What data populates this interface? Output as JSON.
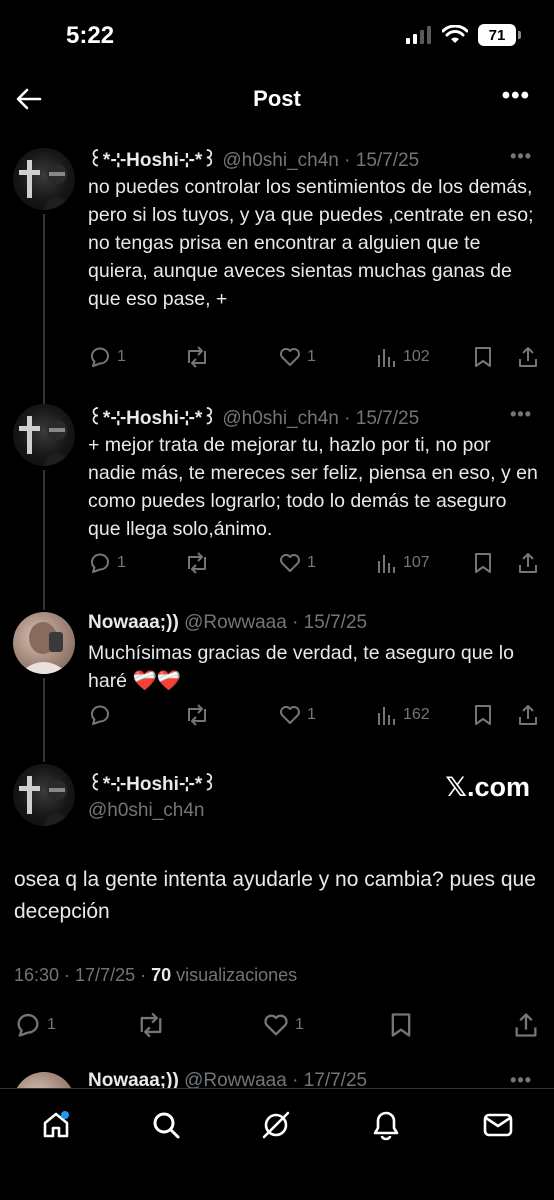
{
  "status_bar": {
    "time": "5:22",
    "battery": "71"
  },
  "header": {
    "title": "Post"
  },
  "tweets": [
    {
      "display_name": "꒰*⊹Hoshi⊹*꒱",
      "handle": "@h0shi_ch4n",
      "date": "· 15/7/25",
      "text": "no puedes controlar los sentimientos de los demás, pero si los tuyos, y ya que puedes ,centrate en eso; no tengas prisa en encontrar a alguien que te quiera, aunque aveces sientas muchas ganas de que eso pase, +",
      "replies": "1",
      "reposts": "",
      "likes": "1",
      "views": "102"
    },
    {
      "display_name": "꒰*⊹Hoshi⊹*꒱",
      "handle": "@h0shi_ch4n",
      "date": "· 15/7/25",
      "text": "+ mejor trata de mejorar tu, hazlo por ti, no por nadie más, te mereces ser feliz, piensa en eso, y en como puedes lograrlo; todo lo demás te aseguro que llega solo,ánimo.",
      "replies": "1",
      "reposts": "",
      "likes": "1",
      "views": "107"
    },
    {
      "display_name": "Nowaaa;))",
      "handle": "@Rowwaaa",
      "date": "· 15/7/25",
      "text": "Muchísimas gracias de verdad, te aseguro que lo haré ❤️‍🩹❤️‍🩹",
      "replies": "",
      "reposts": "",
      "likes": "1",
      "views": "162"
    }
  ],
  "main_post": {
    "display_name": "꒰*⊹Hoshi⊹*꒱",
    "handle": "@h0shi_ch4n",
    "source": "𝕏.com",
    "text": "osea q la gente intenta ayudarle y no cambia? pues que decepción",
    "time": "16:30 · 17/7/25 · ",
    "views_count": "70",
    "views_label": " visualizaciones",
    "replies": "1",
    "reposts": "",
    "likes": "1"
  },
  "next_reply": {
    "display_name": "Nowaaa;))",
    "handle": "@Rowwaaa",
    "date": "· 17/7/25"
  },
  "icons": [
    "back-arrow-icon",
    "more-icon",
    "reply-icon",
    "repost-icon",
    "like-icon",
    "views-icon",
    "bookmark-icon",
    "share-icon",
    "home-icon",
    "search-icon",
    "grok-icon",
    "notifications-icon",
    "messages-icon"
  ],
  "colors": {
    "background": "#000000",
    "text": "#e7e9ea",
    "muted": "#71767b",
    "accent": "#1d9bf0"
  }
}
